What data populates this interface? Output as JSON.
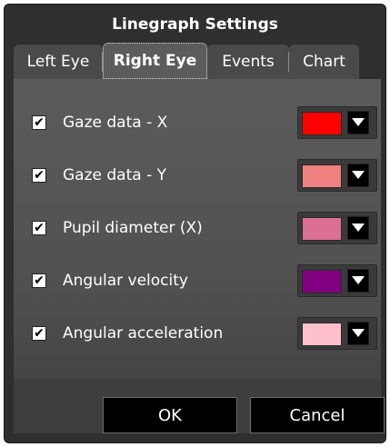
{
  "dialog": {
    "title": "Linegraph Settings",
    "tabs": [
      {
        "label": "Left Eye",
        "active": false
      },
      {
        "label": "Right Eye",
        "active": true
      },
      {
        "label": "Events",
        "active": false
      },
      {
        "label": "Chart",
        "active": false
      }
    ],
    "rows": [
      {
        "label": "Gaze data - X",
        "checked": true,
        "color": "#ff0000"
      },
      {
        "label": "Gaze data - Y",
        "checked": true,
        "color": "#f08080"
      },
      {
        "label": "Pupil diameter (X)",
        "checked": true,
        "color": "#db7093"
      },
      {
        "label": "Angular velocity",
        "checked": true,
        "color": "#800080"
      },
      {
        "label": "Angular acceleration",
        "checked": true,
        "color": "#ffc0cb"
      }
    ],
    "check_glyph": "✔",
    "buttons": {
      "ok": "OK",
      "cancel": "Cancel"
    }
  }
}
